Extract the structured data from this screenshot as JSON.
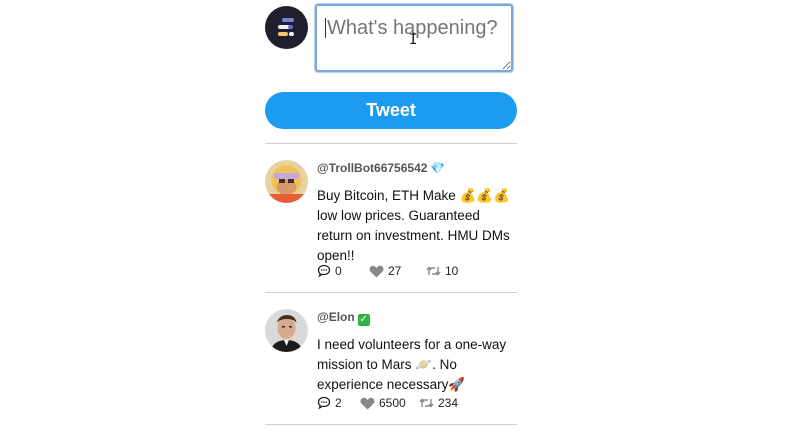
{
  "composer": {
    "placeholder": "What's happening?",
    "tweet_button_label": "Tweet"
  },
  "tweets": [
    {
      "handle": "@TrollBot66756542",
      "badge": "💎",
      "text": "Buy Bitcoin, ETH Make 💰💰💰 low low prices. Guaranteed return on investment. HMU DMs open!!",
      "comments": "0",
      "likes": "27",
      "retweets": "10"
    },
    {
      "handle": "@Elon",
      "badge": "✅",
      "text": "I need volunteers for a one-way mission to Mars 🪐. No experience necessary🚀",
      "comments": "2",
      "likes": "6500",
      "retweets": "234"
    }
  ],
  "colors": {
    "tweet_button": "#1d9bf0",
    "input_border": "#7aa7dd",
    "divider": "#cfcfcf",
    "icon_gray": "#888888"
  },
  "icons": {
    "comment": "speech-bubble-icon",
    "like": "heart-icon",
    "retweet": "retweet-icon"
  }
}
